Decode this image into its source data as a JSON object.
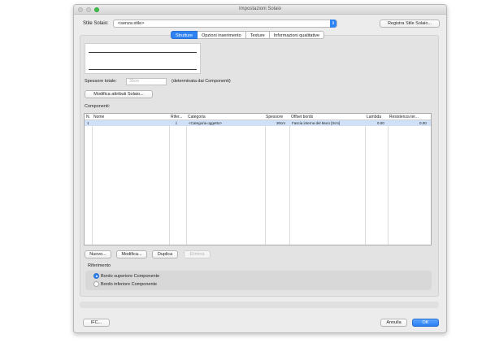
{
  "window": {
    "title": "Impostazioni Solaio"
  },
  "header": {
    "style_label": "Stile Solaio:",
    "style_value": "<senza stile>",
    "register_button": "Registra Stile Solaio..."
  },
  "tabs": [
    {
      "label": "Strutture",
      "active": true
    },
    {
      "label": "Opzioni inserimento",
      "active": false
    },
    {
      "label": "Texture",
      "active": false
    },
    {
      "label": "Informazioni qualitative",
      "active": false
    }
  ],
  "thickness": {
    "label": "Spessore totale:",
    "value": "30cm",
    "note": "(determinata dai Componenti)"
  },
  "modify_attributes_button": "Modifica attributi Solaio...",
  "components": {
    "label": "Componenti:",
    "columns": [
      "N.",
      "Nome",
      "Rifer...",
      "Categoria",
      "Spessore",
      "Offset bordo",
      "Lambda",
      "Resistenza ter..."
    ],
    "rows": [
      {
        "n": "1",
        "nome": "",
        "rif": "⇩",
        "categoria": "<Categoria oggetto>",
        "spessore": "30cm",
        "offset": "Fascia interna del Muro [0cm]",
        "lambda": "0.00",
        "resistenza": "0.00"
      }
    ]
  },
  "list_buttons": {
    "new": "Nuovo...",
    "edit": "Modifica...",
    "duplicate": "Duplica",
    "delete": "Elimina"
  },
  "reference": {
    "label": "Riferimento",
    "options": [
      {
        "label": "Bordo superiore Componente",
        "selected": true
      },
      {
        "label": "Bordo inferiore Componente",
        "selected": false
      }
    ]
  },
  "footer": {
    "ifc": "IFC...",
    "cancel": "Annulla",
    "ok": "OK"
  },
  "colors": {
    "accent": "#2f82f2",
    "selection": "#cfe0f7"
  }
}
